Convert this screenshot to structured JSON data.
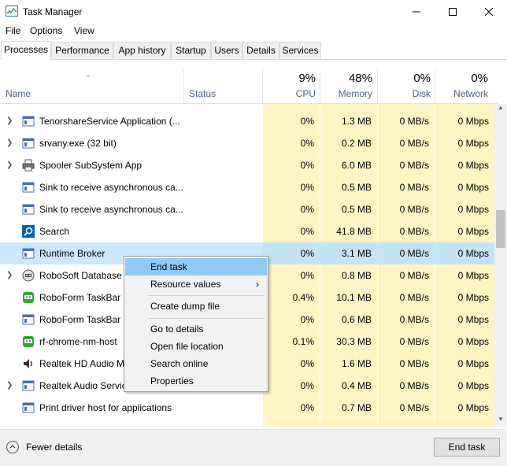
{
  "window": {
    "title": "Task Manager"
  },
  "menu": [
    "File",
    "Options",
    "View"
  ],
  "tabs": [
    "Processes",
    "Performance",
    "App history",
    "Startup",
    "Users",
    "Details",
    "Services"
  ],
  "active_tab": "Processes",
  "columns": {
    "name": "Name",
    "status": "Status",
    "cpu": {
      "pct": "9%",
      "label": "CPU"
    },
    "memory": {
      "pct": "48%",
      "label": "Memory"
    },
    "disk": {
      "pct": "0%",
      "label": "Disk"
    },
    "network": {
      "pct": "0%",
      "label": "Network"
    }
  },
  "processes": [
    {
      "name": "TenorshareService Application (...",
      "expandable": true,
      "icon": "app-window-icon",
      "cpu": "0%",
      "memory": "1.3 MB",
      "disk": "0 MB/s",
      "network": "0 Mbps"
    },
    {
      "name": "srvany.exe (32 bit)",
      "expandable": true,
      "icon": "app-window-icon",
      "cpu": "0%",
      "memory": "0.2 MB",
      "disk": "0 MB/s",
      "network": "0 Mbps"
    },
    {
      "name": "Spooler SubSystem App",
      "expandable": true,
      "icon": "printer-icon",
      "cpu": "0%",
      "memory": "6.0 MB",
      "disk": "0 MB/s",
      "network": "0 Mbps"
    },
    {
      "name": "Sink to receive asynchronous ca...",
      "expandable": false,
      "icon": "app-window-icon",
      "cpu": "0%",
      "memory": "0.5 MB",
      "disk": "0 MB/s",
      "network": "0 Mbps"
    },
    {
      "name": "Sink to receive asynchronous ca...",
      "expandable": false,
      "icon": "app-window-icon",
      "cpu": "0%",
      "memory": "0.5 MB",
      "disk": "0 MB/s",
      "network": "0 Mbps"
    },
    {
      "name": "Search",
      "expandable": false,
      "icon": "search-icon",
      "cpu": "0%",
      "memory": "41.8 MB",
      "disk": "0 MB/s",
      "network": "0 Mbps"
    },
    {
      "name": "Runtime Broker",
      "expandable": false,
      "icon": "app-window-icon",
      "selected": true,
      "cpu": "0%",
      "memory": "3.1 MB",
      "disk": "0 MB/s",
      "network": "0 Mbps"
    },
    {
      "name": "RoboSoft Database S",
      "expandable": true,
      "icon": "robosoft-icon",
      "cpu": "0%",
      "memory": "0.8 MB",
      "disk": "0 MB/s",
      "network": "0 Mbps"
    },
    {
      "name": "RoboForm TaskBar I",
      "expandable": false,
      "icon": "roboform-icon",
      "cpu": "0.4%",
      "memory": "10.1 MB",
      "disk": "0 MB/s",
      "network": "0 Mbps"
    },
    {
      "name": "RoboForm TaskBar I",
      "expandable": false,
      "icon": "app-window-icon",
      "cpu": "0%",
      "memory": "0.6 MB",
      "disk": "0 MB/s",
      "network": "0 Mbps"
    },
    {
      "name": "rf-chrome-nm-host",
      "expandable": false,
      "icon": "roboform-icon",
      "cpu": "0.1%",
      "memory": "30.3 MB",
      "disk": "0 MB/s",
      "network": "0 Mbps"
    },
    {
      "name": "Realtek HD Audio M",
      "expandable": false,
      "icon": "speaker-icon",
      "cpu": "0%",
      "memory": "1.6 MB",
      "disk": "0 MB/s",
      "network": "0 Mbps"
    },
    {
      "name": "Realtek Audio Servic",
      "expandable": true,
      "icon": "app-window-icon",
      "cpu": "0%",
      "memory": "0.4 MB",
      "disk": "0 MB/s",
      "network": "0 Mbps"
    },
    {
      "name": "Print driver host for applications",
      "expandable": false,
      "icon": "app-window-icon",
      "cpu": "0%",
      "memory": "0.7 MB",
      "disk": "0 MB/s",
      "network": "0 Mbps"
    }
  ],
  "context_menu": {
    "items": [
      "End task",
      "Resource values",
      "Create dump file",
      "Go to details",
      "Open file location",
      "Search online",
      "Properties"
    ],
    "hovered": "End task",
    "submenu_item": "Resource values"
  },
  "footer": {
    "fewer_details": "Fewer details",
    "end_task": "End task"
  },
  "colors": {
    "accent": "#0078d7",
    "heat": "#fff4c4",
    "selected": "#cce8ff",
    "menu_hover": "#91c9f7"
  }
}
